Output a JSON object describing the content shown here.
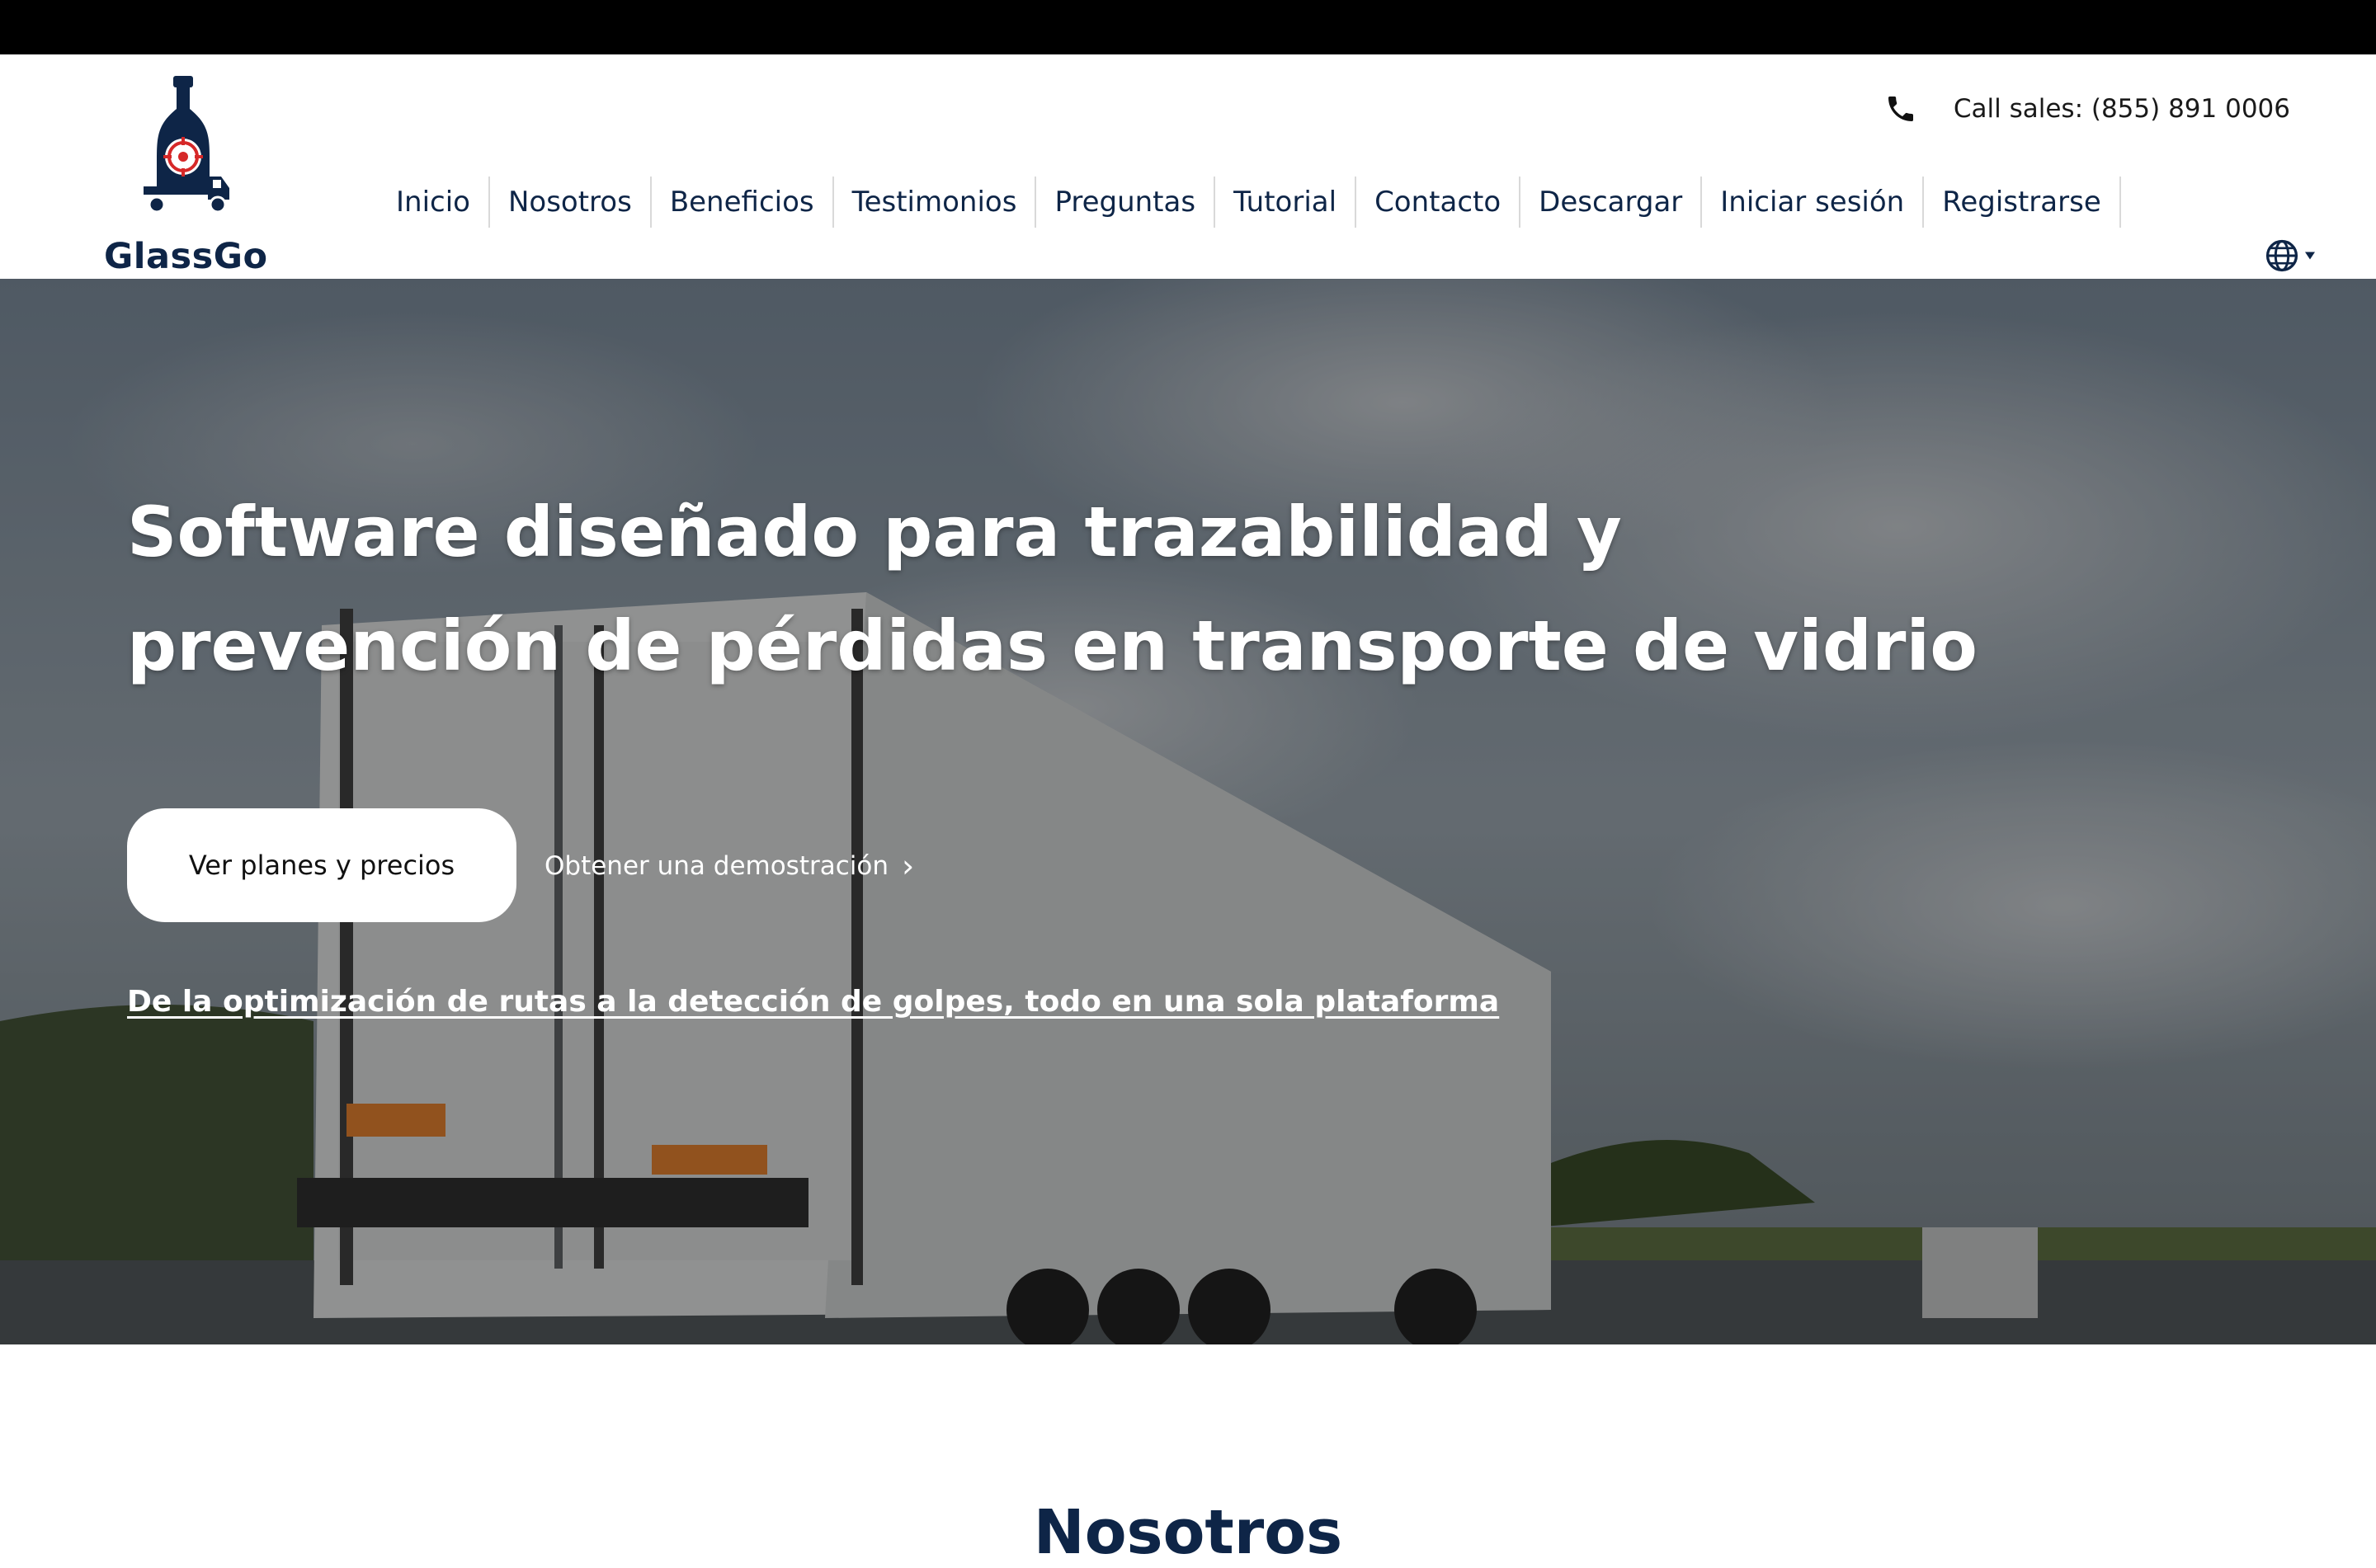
{
  "brand": {
    "name": "GlassGo",
    "primary_color": "#0e2547",
    "accent_color": "#d62828"
  },
  "header": {
    "phone_icon": "phone-icon",
    "phone_text": "Call sales: (855) 891 0006",
    "language_icon": "globe-icon"
  },
  "nav": {
    "items": [
      "Inicio",
      "Nosotros",
      "Beneficios",
      "Testimonios",
      "Preguntas",
      "Tutorial",
      "Contacto",
      "Descargar",
      "Iniciar sesión",
      "Registrarse"
    ]
  },
  "hero": {
    "title_line1": "Software diseñado para trazabilidad y",
    "title_line2": "prevención de pérdidas en transporte de vidrio",
    "primary_button": "Ver planes y precios",
    "secondary_link": "Obtener una demostración",
    "secondary_link_icon": "chevron-right-icon",
    "subtitle": "De la optimización de rutas a la detección de golpes, todo en una sola plataforma",
    "background_image": "white truck on highway under cloudy sky"
  },
  "sections": {
    "about_title": "Nosotros"
  }
}
